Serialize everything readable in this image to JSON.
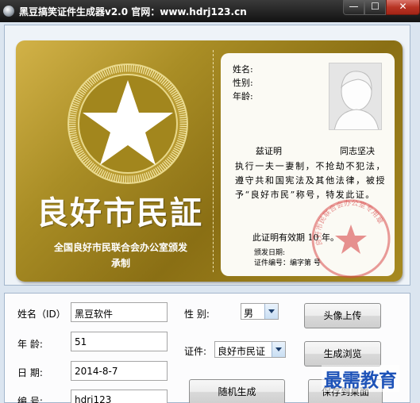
{
  "window": {
    "title": "黑豆搞笑证件生成器v2.0    官网：www.hdrj123.cn",
    "minimize_symbol": "—",
    "maximize_symbol": "☐",
    "close_symbol": "✕"
  },
  "card": {
    "big_title": "良好市民証",
    "issuer_line1": "全国良好市民联合会办公室颁发",
    "issuer_line2": "承制",
    "fields": {
      "name_label": "姓名:",
      "gender_label": "性别:",
      "age_label": "年龄:"
    },
    "cert_heading": "兹证明",
    "cert_motto": "同志坚决",
    "cert_body": "执行一夫一妻制，不抢劫不犯法，遵守共和国宪法及其他法律，被授予“良好市民”称号，特发此证。",
    "validity": "此证明有效期  10  年。",
    "issue_date_label": "颁发日期:",
    "cert_number_label": "证件编号：编字第            号",
    "stamp_text": "良好市民联合会办公室专用章",
    "colors": {
      "gold": "#a98d25",
      "stamp_red": "#d84a4a"
    }
  },
  "form": {
    "name_label": "姓名（ID）",
    "name_value": "黑豆软件",
    "age_label": "年    龄:",
    "age_value": "51",
    "date_label": "日    期:",
    "date_value": "2014-8-7",
    "number_label": "编    号:",
    "number_value": "hdrj123",
    "gender_label": "性    别:",
    "gender_value": "男",
    "cert_label": "证件:",
    "cert_value": "良好市民证",
    "buttons": {
      "avatar_upload": "头像上传",
      "preview": "生成浏览",
      "random": "随机生成",
      "save_desktop": "保存到桌面"
    }
  },
  "watermark": "最需教育"
}
